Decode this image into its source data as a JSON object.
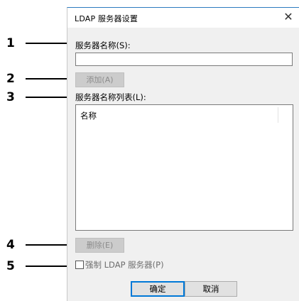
{
  "dialog": {
    "title": "LDAP 服务器设置",
    "close_glyph": "✕",
    "server_name_label": "服务器名称(S):",
    "server_name_value": "",
    "add_button": "添加(A)",
    "server_list_label": "服务器名称列表(L):",
    "list_column_header": "名称",
    "list_items": [],
    "delete_button": "删除(E)",
    "force_ldap_label": "强制 LDAP 服务器(P)",
    "force_ldap_checked": false,
    "ok_button": "确定",
    "cancel_button": "取消"
  },
  "callouts": [
    "1",
    "2",
    "3",
    "4",
    "5"
  ]
}
